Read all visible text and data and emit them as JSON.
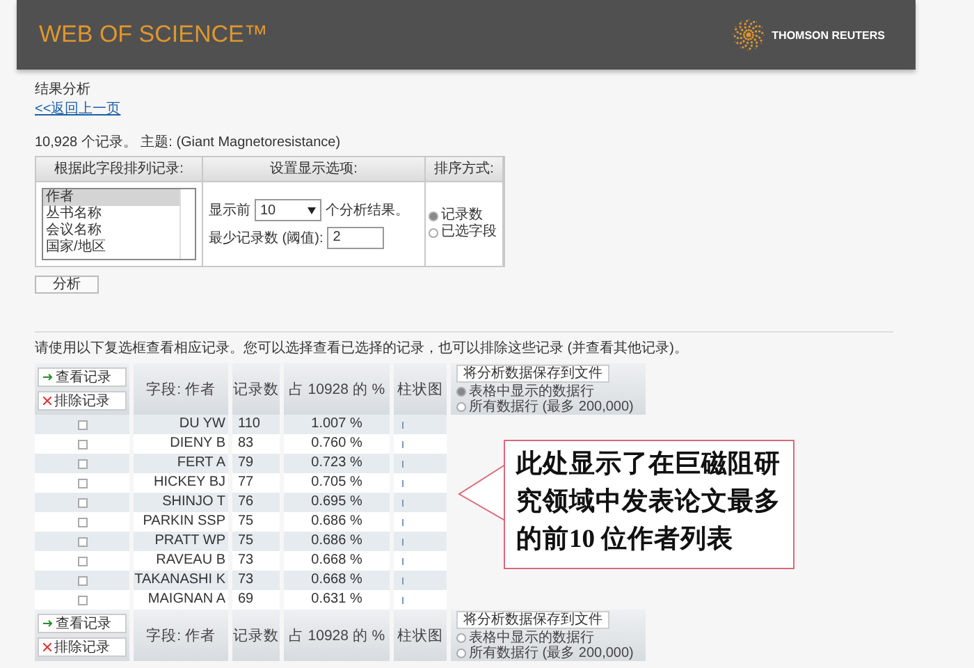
{
  "header": {
    "logo": "WEB OF SCIENCE™",
    "brand": "THOMSON REUTERS"
  },
  "page_title": "结果分析",
  "back_link": "<<返回上一页",
  "summary": "10,928 个记录。 主题: (Giant Magnetoresistance)",
  "options": {
    "rank_header": "根据此字段排列记录:",
    "display_header": "设置显示选项:",
    "sort_header": "排序方式:",
    "fields": [
      {
        "label": "作者",
        "selected": true
      },
      {
        "label": "丛书名称",
        "selected": false
      },
      {
        "label": "会议名称",
        "selected": false
      },
      {
        "label": "国家/地区",
        "selected": false
      }
    ],
    "show_prefix": "显示前",
    "show_count": "10",
    "show_suffix": "个分析结果。",
    "min_label": "最少记录数 (阈值):",
    "min_value": "2",
    "sort_options": [
      {
        "label": "记录数",
        "selected": true
      },
      {
        "label": "已选字段",
        "selected": false
      }
    ],
    "analyze_button": "分析"
  },
  "instruction": "请使用以下复选框查看相应记录。您可以选择查看已选择的记录，也可以排除这些记录 (并查看其他记录)。",
  "results": {
    "header": {
      "view_button": "查看记录",
      "exclude_button": "排除记录",
      "columns": [
        "字段: 作者",
        "记录数",
        "占 10928 的 %",
        "柱状图"
      ],
      "save_button": "将分析数据保存到文件",
      "save_options": [
        {
          "label": "表格中显示的数据行",
          "selected": true
        },
        {
          "label": "所有数据行 (最多 200,000)",
          "selected": false
        }
      ]
    },
    "rows": [
      {
        "name": "DU YW",
        "count": "110",
        "percent": "1.007 %",
        "checked": false
      },
      {
        "name": "DIENY B",
        "count": "83",
        "percent": "0.760 %",
        "checked": false
      },
      {
        "name": "FERT A",
        "count": "79",
        "percent": "0.723 %",
        "checked": false
      },
      {
        "name": "HICKEY BJ",
        "count": "77",
        "percent": "0.705 %",
        "checked": false
      },
      {
        "name": "SHINJO T",
        "count": "76",
        "percent": "0.695 %",
        "checked": false
      },
      {
        "name": "PARKIN SSP",
        "count": "75",
        "percent": "0.686 %",
        "checked": false
      },
      {
        "name": "PRATT WP",
        "count": "75",
        "percent": "0.686 %",
        "checked": false
      },
      {
        "name": "RAVEAU B",
        "count": "73",
        "percent": "0.668 %",
        "checked": false
      },
      {
        "name": "TAKANASHI K",
        "count": "73",
        "percent": "0.668 %",
        "checked": false
      },
      {
        "name": "MAIGNAN A",
        "count": "69",
        "percent": "0.631 %",
        "checked": false
      }
    ],
    "footer": {
      "view_button": "查看记录",
      "exclude_button": "排除记录",
      "columns": [
        "字段: 作者",
        "记录数",
        "占 10928 的 %",
        "柱状图"
      ],
      "save_button": "将分析数据保存到文件",
      "save_options": [
        {
          "label": "表格中显示的数据行",
          "selected": false
        },
        {
          "label": "所有数据行 (最多 200,000)",
          "selected": false
        }
      ]
    }
  },
  "callout": "此处显示了在巨磁阻研究领域中发表论文最多的前10 位作者列表"
}
